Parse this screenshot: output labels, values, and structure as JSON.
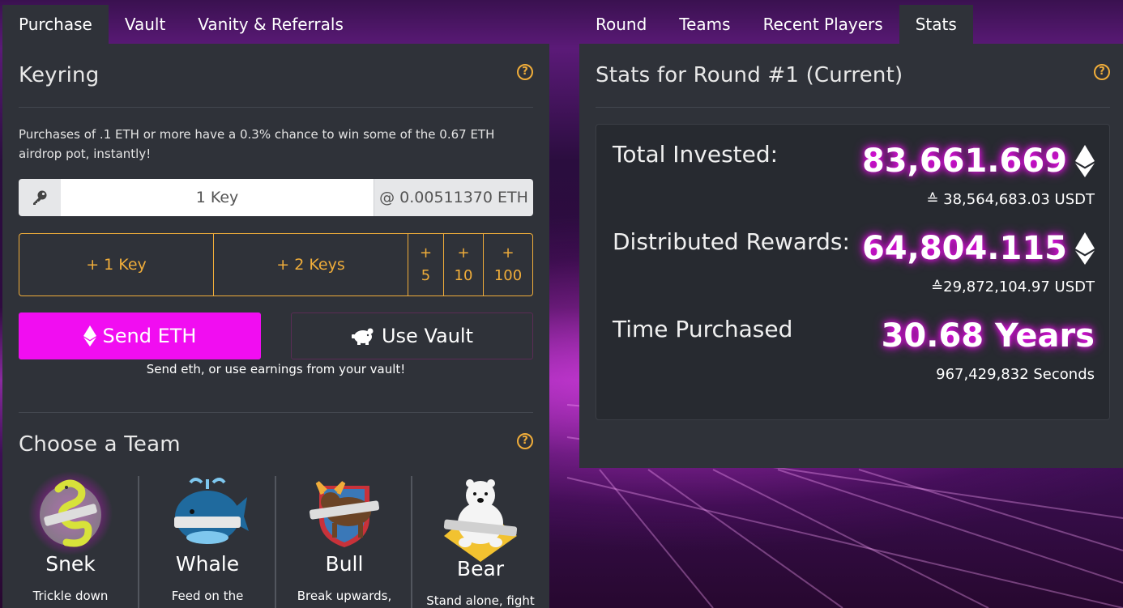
{
  "left_tabs": [
    "Purchase",
    "Vault",
    "Vanity & Referrals"
  ],
  "right_tabs": [
    "Round",
    "Teams",
    "Recent Players",
    "Stats"
  ],
  "keyring": {
    "title": "Keyring",
    "help": "?",
    "note": "Purchases of .1 ETH or more have a 0.3% chance to win some of the 0.67 ETH airdrop pot, instantly!",
    "input_value": "1 Key",
    "price": "@ 0.00511370 ETH",
    "key_icon": "key-icon",
    "buttons": {
      "plus1": "+ 1 Key",
      "plus2": "+ 2 Keys",
      "plus5_sign": "+",
      "plus5": "5",
      "plus10_sign": "+",
      "plus10": "10",
      "plus100_sign": "+",
      "plus100": "100"
    },
    "send_label": "Send ETH",
    "vault_label": "Use Vault",
    "caption": "Send eth, or use earnings from your vault!"
  },
  "choose_team": {
    "title": "Choose a Team",
    "help": "?",
    "teams": [
      {
        "name": "Snek",
        "desc": "Trickle down"
      },
      {
        "name": "Whale",
        "desc": "Feed on the"
      },
      {
        "name": "Bull",
        "desc": "Break upwards,"
      },
      {
        "name": "Bear",
        "desc": "Stand alone, fight"
      }
    ]
  },
  "stats": {
    "title": "Stats for Round #1 (Current)",
    "help": "?",
    "total_invested_label": "Total Invested:",
    "total_invested_value": "83,661.669",
    "total_invested_usdt": "≙ 38,564,683.03 USDT",
    "distributed_label": "Distributed Rewards:",
    "distributed_value": "64,804.115",
    "distributed_usdt": "≙29,872,104.97 USDT",
    "time_label": "Time Purchased",
    "time_value": "30.68 Years",
    "time_seconds": "967,429,832 Seconds"
  },
  "colors": {
    "accent_orange": "#f0ad3a",
    "magenta": "#f10df1",
    "panel": "#2f3239"
  }
}
